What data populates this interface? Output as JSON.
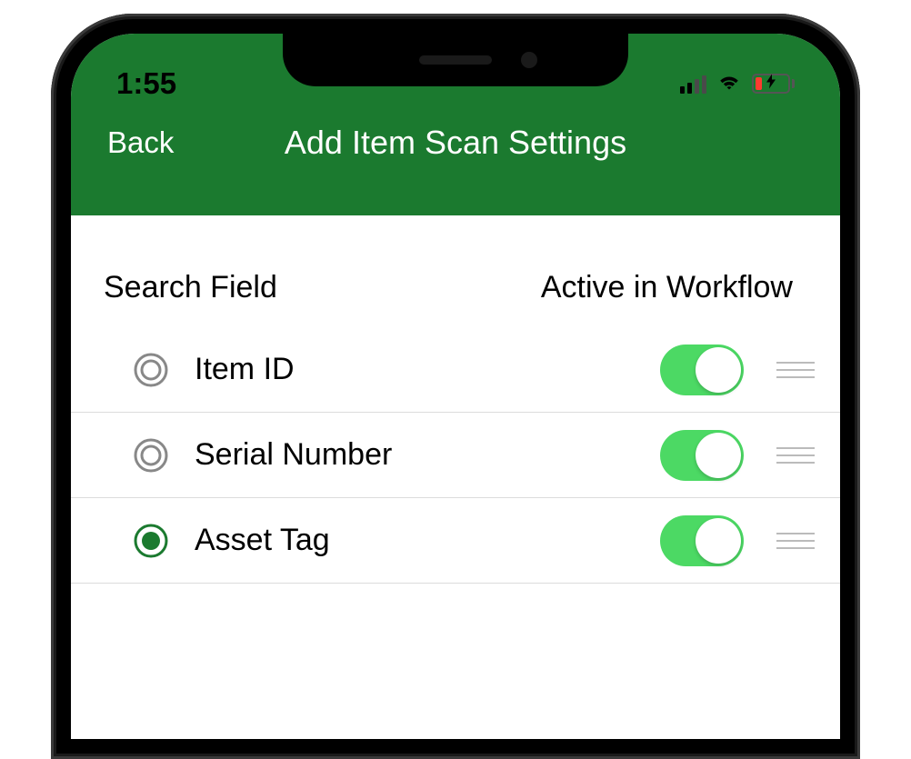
{
  "status_bar": {
    "time": "1:55"
  },
  "nav": {
    "back_label": "Back",
    "title": "Add Item Scan Settings"
  },
  "headers": {
    "left": "Search Field",
    "right": "Active in Workflow"
  },
  "rows": [
    {
      "label": "Item ID",
      "selected": false,
      "active": true
    },
    {
      "label": "Serial Number",
      "selected": false,
      "active": true
    },
    {
      "label": "Asset Tag",
      "selected": true,
      "active": true
    }
  ],
  "colors": {
    "header_green": "#1b7a2f",
    "toggle_green": "#4cd964",
    "radio_selected": "#1b7a2f",
    "battery_low": "#ff3b30"
  }
}
